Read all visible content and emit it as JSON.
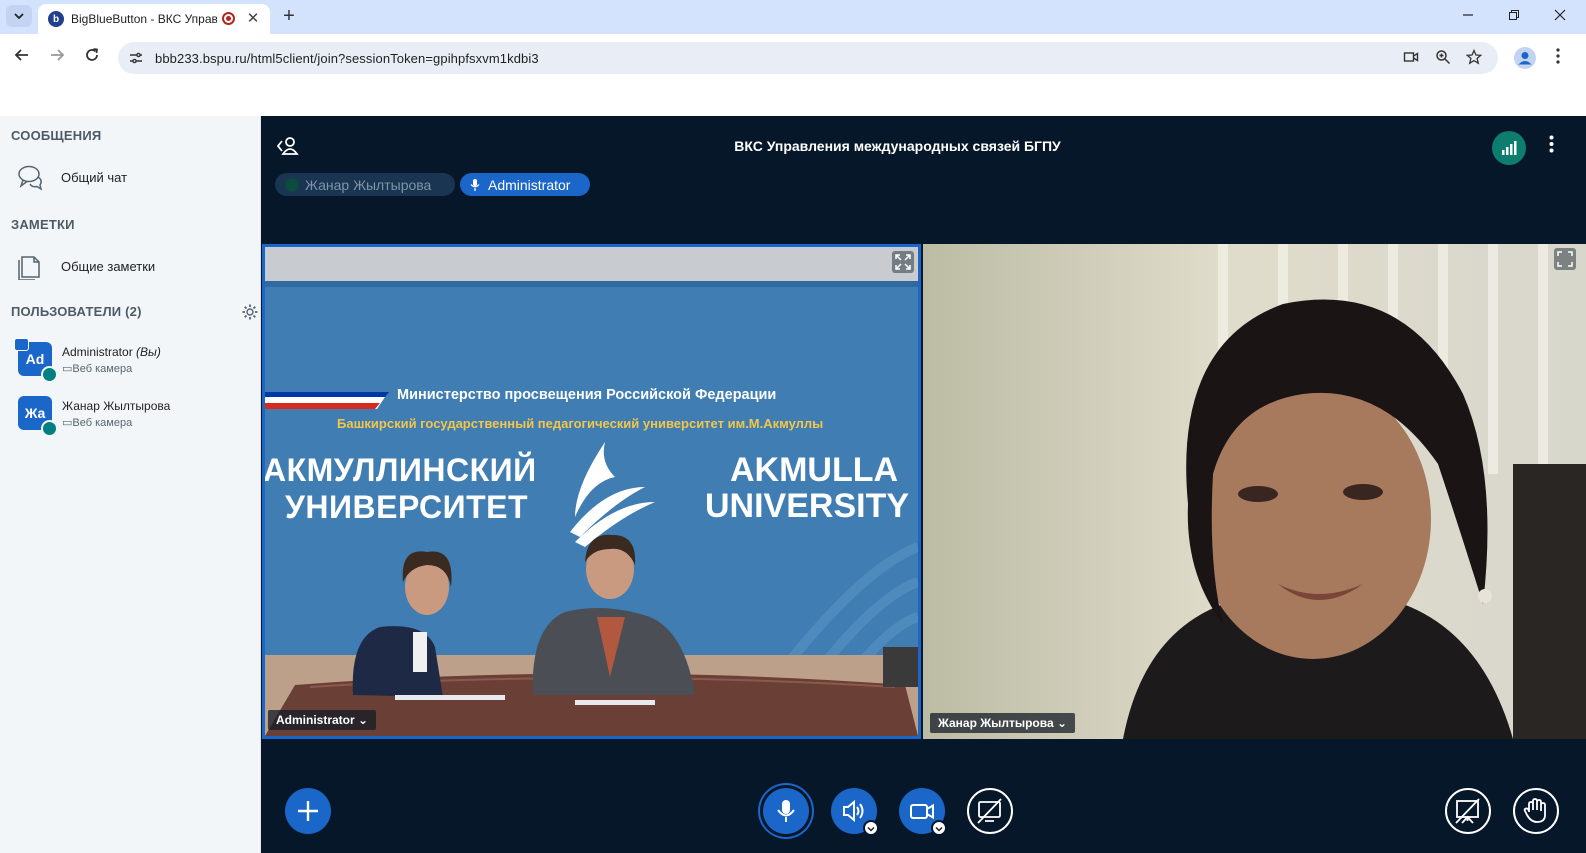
{
  "browser": {
    "tab_title": "BigBlueButton - ВКС Управ",
    "url": "bbb233.bspu.ru/html5client/join?sessionToken=gpihpfsxvm1kdbi3",
    "favicon_letter": "b",
    "new_tab_label": "+",
    "close_tab_label": "✕"
  },
  "sidebar": {
    "messages_heading": "СООБЩЕНИЯ",
    "public_chat_label": "Общий чат",
    "notes_heading": "ЗАМЕТКИ",
    "shared_notes_label": "Общие заметки",
    "users_heading": "ПОЛЬЗОВАТЕЛИ (2)",
    "users": [
      {
        "initials": "Ad",
        "name": "Administrator",
        "you_suffix": "(Вы)",
        "status": "Веб камера",
        "is_presenter": true
      },
      {
        "initials": "Жа",
        "name": "Жанар Жылтырова",
        "you_suffix": "",
        "status": "Веб камера",
        "is_presenter": false
      }
    ]
  },
  "main": {
    "meeting_title": "ВКС Управления международных связей БГПУ",
    "talking": [
      {
        "name": "Жанар Жылтырова",
        "active": false
      },
      {
        "name": "Administrator",
        "active": true
      }
    ],
    "videos": [
      {
        "name_tag": "Administrator ⌄",
        "backdrop": {
          "ministry": "Министерство просвещения Российской Федерации",
          "university_full": "Башкирский государственный педагогический университет им.М.Акмуллы",
          "ru_line1": "АКМУЛЛИНСКИЙ",
          "ru_line2": "УНИВЕРСИТЕТ",
          "en_line1": "AKMULLA",
          "en_line2": "UNIVERSITY"
        }
      },
      {
        "name_tag": "Жанар Жылтырова ⌄"
      }
    ]
  },
  "colors": {
    "accent": "#1b66c9",
    "app_background": "#06172a",
    "sidebar_background": "#f3f6f9",
    "connection_ok": "#0d7d6f"
  }
}
